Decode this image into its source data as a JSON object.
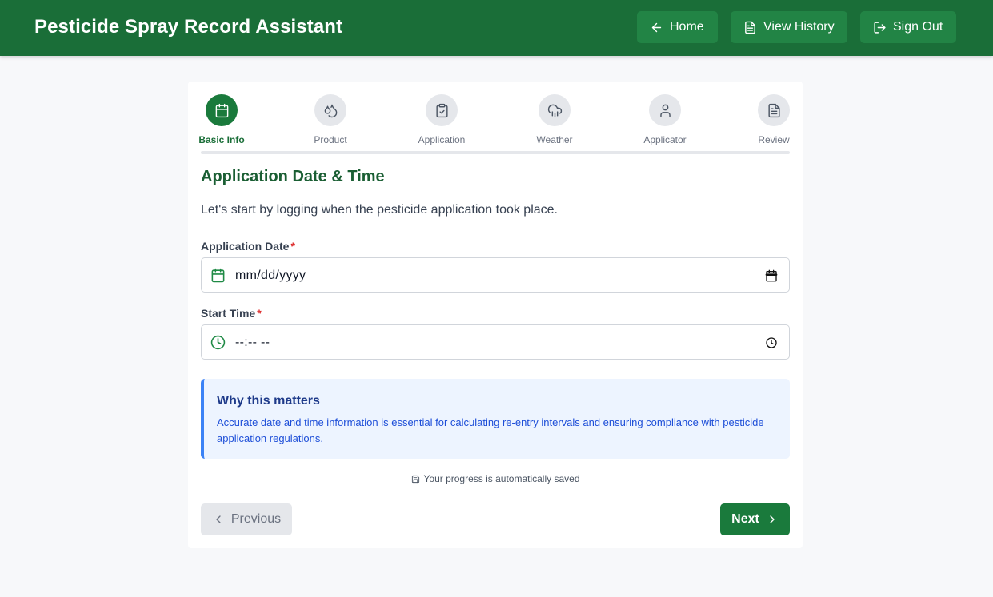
{
  "header": {
    "title": "Pesticide Spray Record Assistant",
    "buttons": {
      "home": "Home",
      "view_history": "View History",
      "sign_out": "Sign Out"
    }
  },
  "steps": [
    {
      "label": "Basic Info",
      "icon": "calendar-icon",
      "active": true
    },
    {
      "label": "Product",
      "icon": "droplets-icon",
      "active": false
    },
    {
      "label": "Application",
      "icon": "clipboard-check-icon",
      "active": false
    },
    {
      "label": "Weather",
      "icon": "cloud-rain-icon",
      "active": false
    },
    {
      "label": "Applicator",
      "icon": "user-icon",
      "active": false
    },
    {
      "label": "Review",
      "icon": "file-text-icon",
      "active": false
    }
  ],
  "form": {
    "section_title": "Application Date & Time",
    "intro": "Let's start by logging when the pesticide application took place.",
    "date": {
      "label": "Application Date",
      "required_mark": "*",
      "value": "mm/dd/yyyy"
    },
    "time": {
      "label": "Start Time",
      "required_mark": "*",
      "value": "--:-- --"
    }
  },
  "info": {
    "title": "Why this matters",
    "text": "Accurate date and time information is essential for calculating re-entry intervals and ensuring compliance with pesticide application regulations."
  },
  "autosave_text": "Your progress is automatically saved",
  "nav": {
    "previous": "Previous",
    "next": "Next"
  },
  "colors": {
    "brand": "#1a6e38",
    "accent": "#1a7a3c",
    "info": "#3b82f6",
    "required": "#dc2626"
  }
}
